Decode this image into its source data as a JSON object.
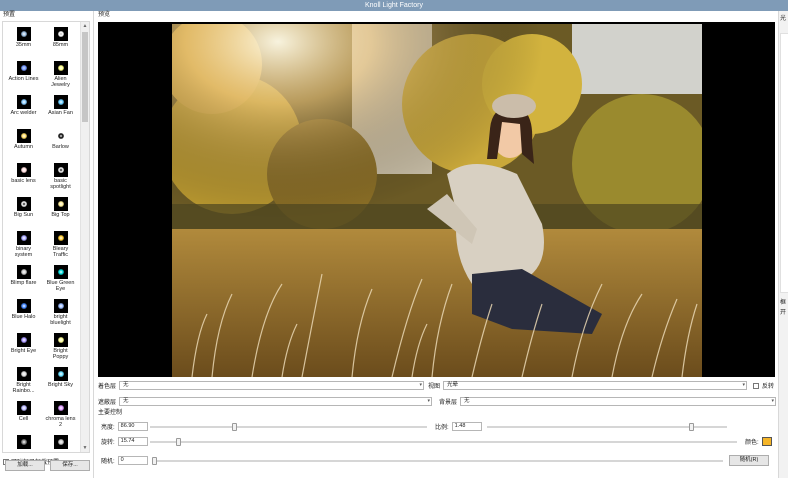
{
  "window": {
    "title": "Knoll Light Factory"
  },
  "presets": {
    "title": "预置",
    "items": [
      {
        "label": "35mm",
        "icon": "flare-thumbnail-icon"
      },
      {
        "label": "85mm",
        "icon": "flare-thumbnail-icon"
      },
      {
        "label": "Action Lines",
        "icon": "flare-thumbnail-icon"
      },
      {
        "label": "Alien\nJewelry",
        "icon": "flare-thumbnail-icon"
      },
      {
        "label": "Arc welder",
        "icon": "flare-thumbnail-icon"
      },
      {
        "label": "Asian Fan",
        "icon": "flare-thumbnail-icon"
      },
      {
        "label": "Autumn",
        "icon": "flare-thumbnail-icon"
      },
      {
        "label": "Barlow",
        "icon": "flare-thumbnail-icon"
      },
      {
        "label": "basic lens",
        "icon": "flare-thumbnail-icon"
      },
      {
        "label": "basic\nspotlight",
        "icon": "flare-thumbnail-icon"
      },
      {
        "label": "Big Sun",
        "icon": "flare-thumbnail-icon"
      },
      {
        "label": "Big Top",
        "icon": "flare-thumbnail-icon"
      },
      {
        "label": "binary\nsystem",
        "icon": "flare-thumbnail-icon"
      },
      {
        "label": "Bleary\nTraffic",
        "icon": "flare-thumbnail-icon"
      },
      {
        "label": "Blimp flare",
        "icon": "flare-thumbnail-icon"
      },
      {
        "label": "Blue Green\nEye",
        "icon": "flare-thumbnail-icon"
      },
      {
        "label": "Blue Halo",
        "icon": "flare-thumbnail-icon"
      },
      {
        "label": "bright\nbluelight",
        "icon": "flare-thumbnail-icon"
      },
      {
        "label": "Bright Eye",
        "icon": "flare-thumbnail-icon"
      },
      {
        "label": "Bright\nPoppy",
        "icon": "flare-thumbnail-icon"
      },
      {
        "label": "Bright\nRainbo...",
        "icon": "flare-thumbnail-icon"
      },
      {
        "label": "Bright Sky",
        "icon": "flare-thumbnail-icon"
      },
      {
        "label": "Cell",
        "icon": "flare-thumbnail-icon"
      },
      {
        "label": "chroma lens\n2",
        "icon": "flare-thumbnail-icon"
      },
      {
        "label": "",
        "icon": "flare-thumbnail-icon"
      },
      {
        "label": "",
        "icon": "flare-thumbnail-icon"
      }
    ],
    "folder_checkbox": "可附加已加载预置",
    "load_button": "加载...",
    "save_button": "保存..."
  },
  "preview": {
    "label": "预览"
  },
  "controls": {
    "color_gel_label": "着色层",
    "color_gel_value": "无",
    "view_label": "视图",
    "view_value": "光晕",
    "reverse_label": "反转",
    "occlusion_label": "遮蔽层",
    "occlusion_value": "无",
    "background_label": "背景层",
    "background_value": "无",
    "main_group_label": "主要控制",
    "brightness_label": "亮度:",
    "brightness_value": "86.90",
    "brightness_level": 0.3,
    "scale_label": "比例:",
    "scale_value": "1.48",
    "scale_level": 0.86,
    "rotation_label": "旋转:",
    "rotation_value": "15.74",
    "rotation_level": 0.044,
    "color_label": "颜色:",
    "color_value": "#f5b528",
    "random_label": "随机:",
    "random_value": "0",
    "random_level": 0.0,
    "random_button": "随机(R)"
  },
  "right_panel": {
    "labels": [
      "光",
      "框",
      "开"
    ]
  }
}
